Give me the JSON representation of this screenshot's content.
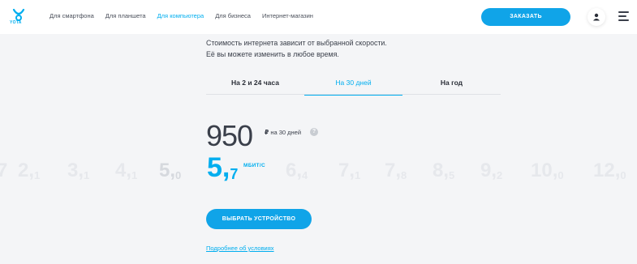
{
  "header": {
    "logo_text": "YOTA",
    "nav": [
      {
        "label": "Для смартфона",
        "active": false
      },
      {
        "label": "Для планшета",
        "active": false
      },
      {
        "label": "Для компьютера",
        "active": true
      },
      {
        "label": "Для бизнеса",
        "active": false
      },
      {
        "label": "Интернет-магазин",
        "active": false
      }
    ],
    "order_label": "ЗАКАЗАТЬ",
    "user_icon": "user-icon",
    "menu_icon": "menu-icon"
  },
  "main": {
    "description_line1": "Стоимость интернета зависит от выбранной скорости.",
    "description_line2": "Её вы можете изменить в любое время.",
    "tabs": [
      {
        "label": "На 2 и 24 часа",
        "active": false
      },
      {
        "label": "На 30 дней",
        "active": true
      },
      {
        "label": "На год",
        "active": false
      }
    ],
    "price": "950",
    "currency": "₽",
    "price_period": "на 30 дней",
    "help_icon": "?",
    "speed_unit": "МБИТ/С",
    "speed_scale": [
      {
        "int": "7",
        "dec": ""
      },
      {
        "int": "2,",
        "dec": "1"
      },
      {
        "int": "3,",
        "dec": "1"
      },
      {
        "int": "4,",
        "dec": "1"
      },
      {
        "int": "5,",
        "dec": "0"
      },
      {
        "int": "5,",
        "dec": "7"
      },
      {
        "int": "6,",
        "dec": "4"
      },
      {
        "int": "7,",
        "dec": "1"
      },
      {
        "int": "7,",
        "dec": "8"
      },
      {
        "int": "8,",
        "dec": "5"
      },
      {
        "int": "9,",
        "dec": "2"
      },
      {
        "int": "10,",
        "dec": "0"
      },
      {
        "int": "12,",
        "dec": "0"
      }
    ],
    "current_speed": "5,7",
    "choose_device_label": "ВЫБРАТЬ УСТРОЙСТВО",
    "terms_link": "Подробнее об условиях"
  },
  "colors": {
    "accent": "#00aeef",
    "button": "#10a4e8",
    "background": "#f4f5f7"
  }
}
